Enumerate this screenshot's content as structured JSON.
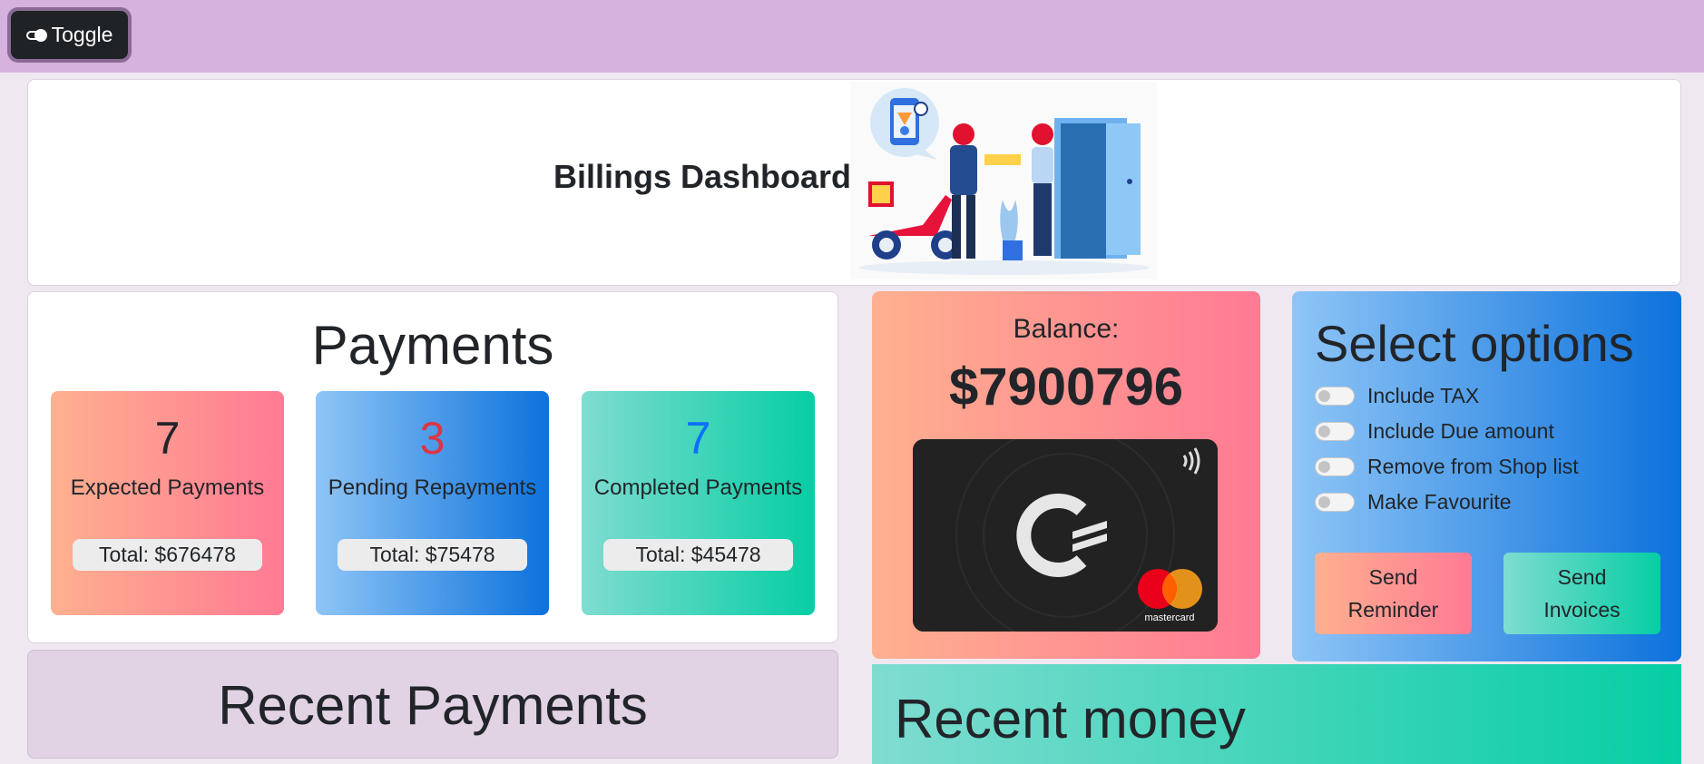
{
  "topbar": {
    "toggle_label": "Toggle",
    "toggle_icon": "toggle-icon",
    "color": "#d5b3de"
  },
  "header": {
    "title": "Billings Dashboard",
    "illustration": "delivery-illustration"
  },
  "payments": {
    "title": "Payments",
    "stats": [
      {
        "count": "7",
        "count_color": "#212529",
        "label": "Expected Payments",
        "total": "Total: $676478"
      },
      {
        "count": "3",
        "count_color": "#dc3545",
        "label": "Pending Repayments",
        "total": "Total: $75478"
      },
      {
        "count": "7",
        "count_color": "#0d6efd",
        "label": "Completed Payments",
        "total": "Total: $45478"
      }
    ]
  },
  "balance": {
    "label": "Balance:",
    "amount": "$7900796",
    "card_brand": "mastercard"
  },
  "options": {
    "title": "Select options",
    "items": [
      {
        "label": "Include TAX",
        "checked": false
      },
      {
        "label": "Include Due amount",
        "checked": false
      },
      {
        "label": "Remove from Shop list",
        "checked": false
      },
      {
        "label": "Make Favourite",
        "checked": false
      }
    ],
    "send_reminder": "Send Reminder",
    "send_invoices": "Send Invoices"
  },
  "recent_payments": {
    "title": "Recent Payments"
  },
  "recent_money": {
    "title": "Recent money"
  },
  "colors": {
    "orange_gradient": [
      "#ffb08f",
      "#ff7a93"
    ],
    "blue_gradient": [
      "#8fc5f6",
      "#0c72dc"
    ],
    "teal_gradient": [
      "#7fdcd1",
      "#06cea4"
    ]
  }
}
